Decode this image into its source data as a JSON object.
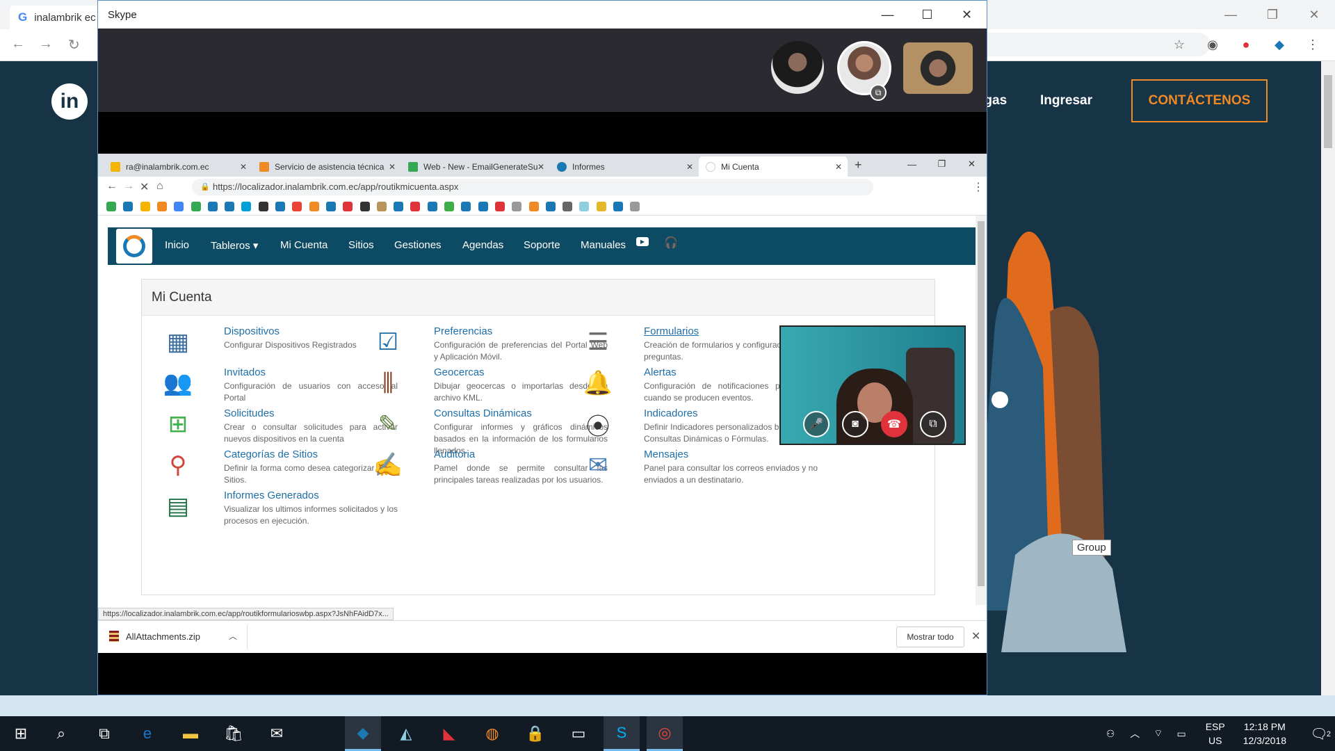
{
  "bg_browser": {
    "tab_title": "inalambrik ec",
    "site_menu": [
      "rgas",
      "Ingresar"
    ],
    "cta": "CONTÁCTENOS",
    "group_tooltip": "Group"
  },
  "skype": {
    "title": "Skype"
  },
  "inner_browser": {
    "tabs": [
      {
        "label": "ra@inalambrik.com.ec",
        "color": "#f4b400"
      },
      {
        "label": "Servicio de asistencia técnica",
        "color": "#f08a24"
      },
      {
        "label": "Web - New - EmailGenerateSu",
        "color": "#34a853"
      },
      {
        "label": "Informes",
        "color": "#1a78b4"
      },
      {
        "label": "Mi Cuenta",
        "color": "#ffffff"
      }
    ],
    "url": "https://localizador.inalambrik.com.ec/app/routikmicuenta.aspx",
    "status_url": "https://localizador.inalambrik.com.ec/app/routikformularioswbp.aspx?JsNhFAidD7x...",
    "download_file": "AllAttachments.zip",
    "show_all": "Mostrar todo"
  },
  "app": {
    "menu": [
      "Inicio",
      "Tableros",
      "Mi Cuenta",
      "Sitios",
      "Gestiones",
      "Agendas",
      "Soporte",
      "Manuales"
    ],
    "panel_title": "Mi Cuenta",
    "items": [
      {
        "title": "Dispositivos",
        "desc": "Configurar Dispositivos Registrados",
        "icon": "tablet-icon"
      },
      {
        "title": "Invitados",
        "desc": "Configuración de usuarios con acceso al Portal",
        "icon": "users-icon"
      },
      {
        "title": "Solicitudes",
        "desc": "Crear o consultar solicitudes para activar nuevos dispositivos en la cuenta",
        "icon": "add-device-icon"
      },
      {
        "title": "Categorías de Sitios",
        "desc": "Definir la forma como desea categorizar a sus Sitios.",
        "icon": "pins-icon"
      },
      {
        "title": "Informes Generados",
        "desc": "Visualizar los ultimos informes solicitados y los procesos en ejecución.",
        "icon": "pdf-excel-icon"
      },
      {
        "title": "Preferencias",
        "desc": "Configuración de preferencias del Portal Web y Aplicación Móvil.",
        "icon": "checklist-icon"
      },
      {
        "title": "Geocercas",
        "desc": "Dibujar geocercas o importarlas desde un archivo KML.",
        "icon": "fence-icon"
      },
      {
        "title": "Consultas Dinámicas",
        "desc": "Configurar informes y gráficos dinámicos basados en la información de los formularios llenados.",
        "icon": "pencil-chart-icon"
      },
      {
        "title": "Auditoria",
        "desc": "Pamel donde se permite consultar las principales tareas realizadas por los usuarios.",
        "icon": "notepad-icon"
      },
      {
        "title": "Formularios",
        "desc": "Creación de formularios y configuración de las preguntas.",
        "icon": "form-icon"
      },
      {
        "title": "Alertas",
        "desc": "Configuración de notificaciones por correo cuando se producen eventos.",
        "icon": "bell-icon"
      },
      {
        "title": "Indicadores",
        "desc": "Definir Indicadores personalizados basados en Consultas Dinámicas o Fórmulas.",
        "icon": "traffic-light-icon"
      },
      {
        "title": "Mensajes",
        "desc": "Panel para consultar los correos enviados y no enviados a un destinatario.",
        "icon": "mail-globe-icon"
      }
    ]
  },
  "taskbar": {
    "lang_top": "ESP",
    "lang_bottom": "US",
    "time": "12:18 PM",
    "date": "12/3/2018",
    "notif_count": "2"
  }
}
